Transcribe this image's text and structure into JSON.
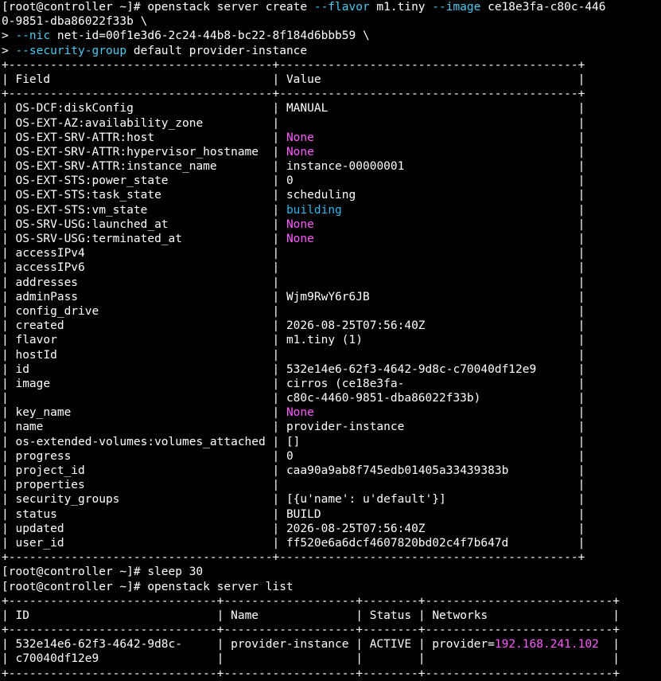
{
  "colors": {
    "background": "#000000",
    "foreground": "#ffffff",
    "flag": "#4ec9f0",
    "none_value": "#ff5cff",
    "status_building": "#2fb5e8",
    "ip_address": "#ff5cff"
  },
  "terminal": {
    "prompt": "[root@controller ~]# ",
    "continuation": "> ",
    "create_command": {
      "cmd_start": "openstack server create ",
      "flag_flavor": "--flavor",
      "flavor_value": " m1.tiny ",
      "flag_image": "--image",
      "image_value_1": " ce18e3fa-c80c-446",
      "image_value_2": "0-9851-dba86022f33b \\",
      "flag_nic": "--nic",
      "nic_value": " net-id=00f1e3d6-2c24-44b8-bc22-8f184d6bbb59 \\",
      "flag_secgroup": "--security-group",
      "secgroup_value": " default provider-instance"
    },
    "show_table": {
      "border": "+--------------------------------------+-------------------------------------------+",
      "header_field": "Field",
      "header_value": "Value",
      "rows": [
        {
          "field": "OS-DCF:diskConfig",
          "value": "MANUAL",
          "style": ""
        },
        {
          "field": "OS-EXT-AZ:availability_zone",
          "value": "",
          "style": ""
        },
        {
          "field": "OS-EXT-SRV-ATTR:host",
          "value": "None",
          "style": "c-mag"
        },
        {
          "field": "OS-EXT-SRV-ATTR:hypervisor_hostname",
          "value": "None",
          "style": "c-mag"
        },
        {
          "field": "OS-EXT-SRV-ATTR:instance_name",
          "value": "instance-00000001",
          "style": ""
        },
        {
          "field": "OS-EXT-STS:power_state",
          "value": "0",
          "style": ""
        },
        {
          "field": "OS-EXT-STS:task_state",
          "value": "scheduling",
          "style": ""
        },
        {
          "field": "OS-EXT-STS:vm_state",
          "value": "building",
          "style": "c-cyan"
        },
        {
          "field": "OS-SRV-USG:launched_at",
          "value": "None",
          "style": "c-mag"
        },
        {
          "field": "OS-SRV-USG:terminated_at",
          "value": "None",
          "style": "c-mag"
        },
        {
          "field": "accessIPv4",
          "value": "",
          "style": ""
        },
        {
          "field": "accessIPv6",
          "value": "",
          "style": ""
        },
        {
          "field": "addresses",
          "value": "",
          "style": ""
        },
        {
          "field": "adminPass",
          "value": "Wjm9RwY6r6JB",
          "style": ""
        },
        {
          "field": "config_drive",
          "value": "",
          "style": ""
        },
        {
          "field": "created",
          "value": "2026-08-25T07:56:40Z",
          "style": ""
        },
        {
          "field": "flavor",
          "value": "m1.tiny (1)",
          "style": ""
        },
        {
          "field": "hostId",
          "value": "",
          "style": ""
        },
        {
          "field": "id",
          "value": "532e14e6-62f3-4642-9d8c-c70040df12e9",
          "style": ""
        },
        {
          "field": "image",
          "value": "cirros (ce18e3fa-",
          "style": ""
        },
        {
          "field": "",
          "value": "c80c-4460-9851-dba86022f33b)",
          "style": ""
        },
        {
          "field": "key_name",
          "value": "None",
          "style": "c-mag"
        },
        {
          "field": "name",
          "value": "provider-instance",
          "style": ""
        },
        {
          "field": "os-extended-volumes:volumes_attached",
          "value": "[]",
          "style": ""
        },
        {
          "field": "progress",
          "value": "0",
          "style": ""
        },
        {
          "field": "project_id",
          "value": "caa90a9ab8f745edb01405a33439383b",
          "style": ""
        },
        {
          "field": "properties",
          "value": "",
          "style": ""
        },
        {
          "field": "security_groups",
          "value": "[{u'name': u'default'}]",
          "style": ""
        },
        {
          "field": "status",
          "value": "BUILD",
          "style": ""
        },
        {
          "field": "updated",
          "value": "2026-08-25T07:56:40Z",
          "style": ""
        },
        {
          "field": "user_id",
          "value": "ff520e6a6dcf4607820bd02c4f7b647d",
          "style": ""
        }
      ]
    },
    "sleep_command": "sleep 30",
    "list_command": "openstack server list",
    "list_table": {
      "border": "+------------------------------+-------------------+--------+---------------------------+",
      "headers": [
        "ID",
        "Name",
        "Status",
        "Networks"
      ],
      "row_line_1": {
        "id": "532e14e6-62f3-4642-9d8c-",
        "name": "provider-instance",
        "status": "ACTIVE",
        "network_prefix": "provider=",
        "network_ip": "192.168.241.102"
      },
      "row_line_2": {
        "id": "c70040df12e9"
      }
    }
  }
}
